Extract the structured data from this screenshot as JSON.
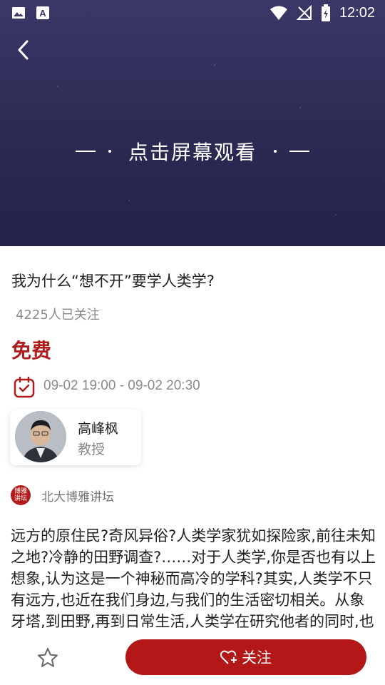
{
  "status_bar": {
    "time": "12:02",
    "icons": [
      "image-icon",
      "a-icon",
      "wifi-icon",
      "no-signal-icon",
      "battery-icon"
    ]
  },
  "video": {
    "play_prompt": "点击屏幕观看"
  },
  "course": {
    "title": "我为什么“想不开”要学人类学?",
    "followers": "4225人已关注",
    "price": "免费",
    "datetime": "09-02 19:00 - 09-02 20:30"
  },
  "lecturer": {
    "name": "高峰枫",
    "title": "教授"
  },
  "organizer": {
    "name": "北大博雅讲坛",
    "logo_text": "博雅讲坛"
  },
  "description": "远方的原住民?奇风异俗?人类学家犹如探险家,前往未知之地?冷静的田野调查?……对于人类学,你是否也有以上想象,认为这是一个神秘而高冷的学科?其实,人类学不只有远方,也近在我们身边,与我们的生活密切相关。从象牙塔,到田野,再到日常生活,人类学在研究他者的同时,也",
  "bottom_bar": {
    "follow_label": "关注"
  },
  "colors": {
    "accent": "#b31717",
    "hero": "#2b2a52"
  }
}
